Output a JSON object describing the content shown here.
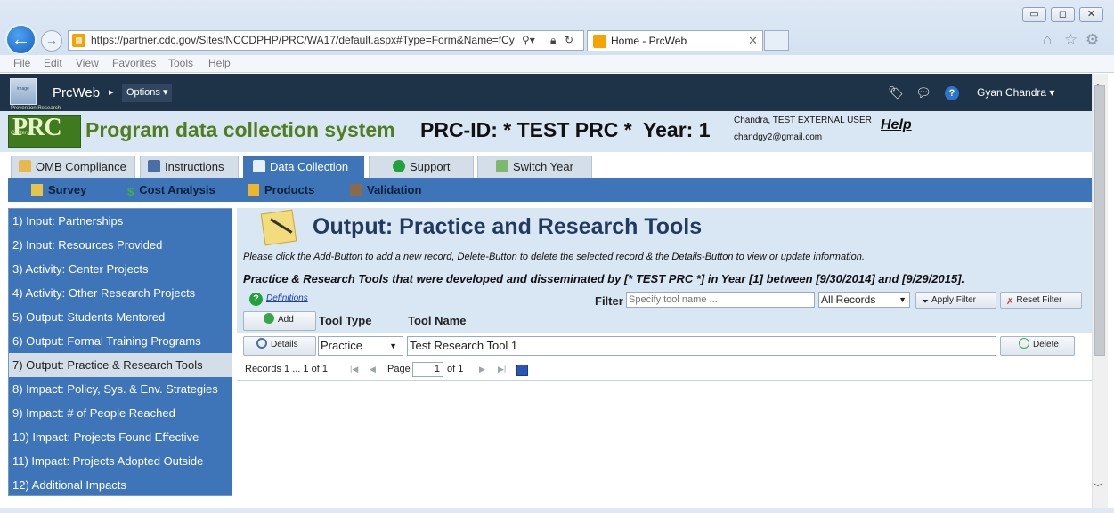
{
  "browser": {
    "url": "https://partner.cdc.gov/Sites/NCCDPHP/PRC/WA17/default.aspx#Type=Form&Name=fCy",
    "tab_title": "Home - PrcWeb",
    "menu": [
      "File",
      "Edit",
      "View",
      "Favorites",
      "Tools",
      "Help"
    ]
  },
  "appbar": {
    "app_name": "PrcWeb",
    "options_label": "Options",
    "user_name": "Gyan Chandra"
  },
  "header": {
    "logo_text": "PRC",
    "logo_sub": "Prevention Research Centers",
    "system_title": "Program data collection system",
    "prc_id": "PRC-ID: * TEST PRC *  Year: 1",
    "user_display": "Chandra, TEST EXTERNAL USER",
    "user_email": "chandgy2@gmail.com",
    "help_link": "Help"
  },
  "main_tabs": [
    {
      "label": "OMB Compliance",
      "active": false
    },
    {
      "label": "Instructions",
      "active": false
    },
    {
      "label": "Data Collection",
      "active": true
    },
    {
      "label": "Support",
      "active": false
    },
    {
      "label": "Switch Year",
      "active": false
    }
  ],
  "sub_nav": [
    {
      "label": "Survey"
    },
    {
      "label": "Cost Analysis"
    },
    {
      "label": "Products"
    },
    {
      "label": "Validation"
    }
  ],
  "sidebar": {
    "items": [
      {
        "label": "1) Input: Partnerships",
        "active": false
      },
      {
        "label": "2) Input: Resources Provided",
        "active": false
      },
      {
        "label": "3) Activity: Center Projects",
        "active": false
      },
      {
        "label": "4) Activity: Other Research Projects",
        "active": false
      },
      {
        "label": "5) Output: Students Mentored",
        "active": false
      },
      {
        "label": "6) Output: Formal Training Programs",
        "active": false
      },
      {
        "label": "7) Output: Practice & Research Tools",
        "active": true
      },
      {
        "label": "8) Impact: Policy, Sys. & Env. Strategies",
        "active": false
      },
      {
        "label": "9) Impact: # of People Reached",
        "active": false
      },
      {
        "label": "10) Impact: Projects Found Effective",
        "active": false
      },
      {
        "label": "11) Impact: Projects Adopted Outside",
        "active": false
      },
      {
        "label": "12) Additional Impacts",
        "active": false
      }
    ]
  },
  "main": {
    "title": "Output: Practice and Research Tools",
    "instructions": "Please click the Add-Button to add a new record, Delete-Button to delete the selected record & the Details-Button to view or update information.",
    "subtitle": "Practice & Research Tools that were developed and disseminated by [* TEST PRC *] in Year [1] between [9/30/2014] and [9/29/2015].",
    "definitions_link": "Definitions",
    "filter": {
      "label": "Filter",
      "placeholder": "Specify tool name ...",
      "select_value": "All Records",
      "apply_label": "Apply Filter",
      "reset_label": "Reset Filter"
    },
    "add_label": "Add",
    "columns": [
      "Tool Type",
      "Tool Name"
    ],
    "rows": [
      {
        "details_label": "Details",
        "tool_type": "Practice",
        "tool_name": "Test Research Tool 1",
        "delete_label": "Delete"
      }
    ],
    "pager": {
      "records_text": "Records 1 ... 1 of 1",
      "page_label": "Page",
      "page_value": "1",
      "of_text": "of 1"
    }
  }
}
